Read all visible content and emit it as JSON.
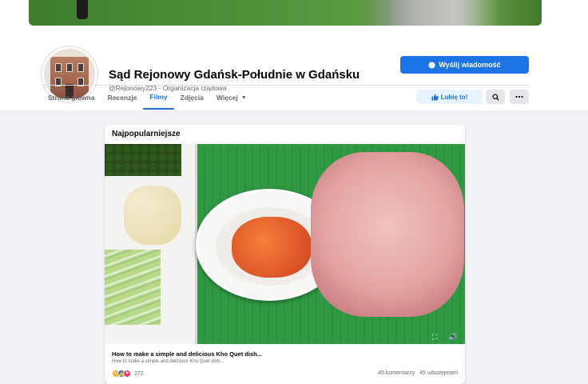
{
  "page": {
    "name": "Sąd Rejonowy Gdańsk-Południe w Gdańsku",
    "handle": "@Rejonowy223",
    "category": "Organizacja rządowa",
    "separator": " · "
  },
  "actions": {
    "message_label": "Wyślij wiadomość",
    "like_label": "Lubię to!",
    "search_icon": "search-icon",
    "more_icon": "more-icon"
  },
  "tabs": [
    {
      "label": "Strona główna",
      "active": false
    },
    {
      "label": "Recenzje",
      "active": false
    },
    {
      "label": "Filmy",
      "active": true
    },
    {
      "label": "Zdjęcia",
      "active": false
    },
    {
      "label": "Więcej",
      "active": false,
      "has_dropdown": true
    }
  ],
  "section": {
    "title": "Najpopularniejsze"
  },
  "video": {
    "title": "How to make a simple and delicious Kho Quet dish...",
    "description": "How to make a simple and delicious Kho Quet dish...",
    "reaction_count": "272",
    "comments": "45 komentarzy",
    "shares": "45 udostępnień"
  },
  "colors": {
    "accent": "#1b74e4",
    "like_bg": "#e7f3ff",
    "background": "#f0f2f5"
  }
}
